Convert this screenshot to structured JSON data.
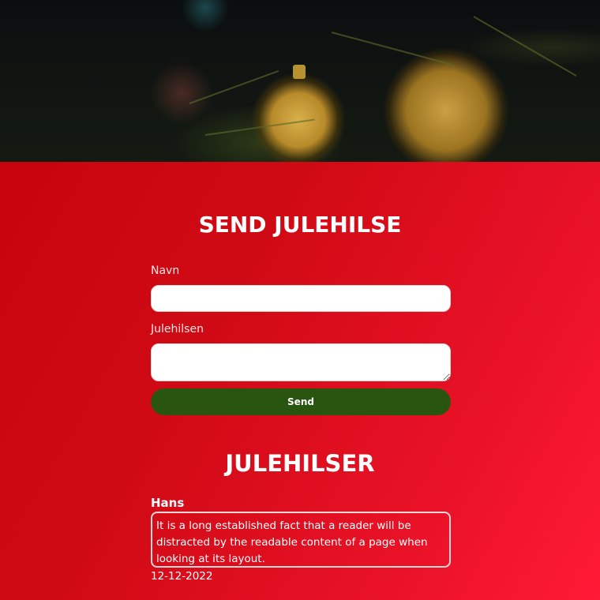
{
  "form": {
    "title": "SEND JULEHILSE",
    "name_label": "Navn",
    "name_value": "",
    "greeting_label": "Julehilsen",
    "greeting_value": "",
    "send_label": "Send"
  },
  "greetings": {
    "title": "JULEHILSER",
    "items": [
      {
        "name": "Hans",
        "message": "It is a long established fact that a reader will be distracted by the readable content of a page when looking at its layout.",
        "date": "12-12-2022"
      }
    ]
  },
  "colors": {
    "accent_red": "#c4060e",
    "button_green": "#2a5510"
  }
}
